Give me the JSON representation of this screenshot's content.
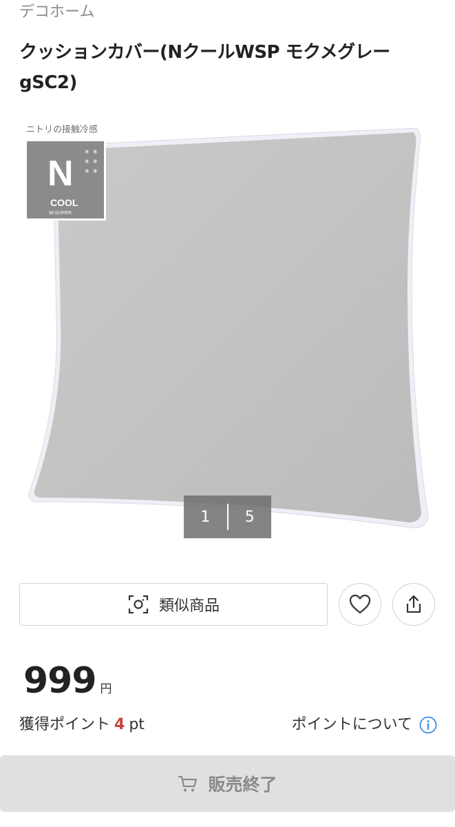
{
  "brand": "デコホーム",
  "product": {
    "title": "クッションカバー(NクールWSP モクメグレーgSC2)"
  },
  "gallery": {
    "badge_caption": "ニトリの接触冷感",
    "badge_text_1": "COOL",
    "badge_text_2": "W-SUPER",
    "current": "1",
    "total": "5"
  },
  "actions": {
    "similar_label": "類似商品",
    "favorite_icon": "heart-icon",
    "share_icon": "share-icon"
  },
  "price": {
    "amount": "999",
    "currency": "円"
  },
  "points": {
    "label": "獲得ポイント",
    "value": "4",
    "unit": "pt",
    "about_label": "ポイントについて",
    "info_color": "#3a8dde"
  },
  "cart": {
    "label": "販売終了",
    "icon": "cart-icon"
  }
}
